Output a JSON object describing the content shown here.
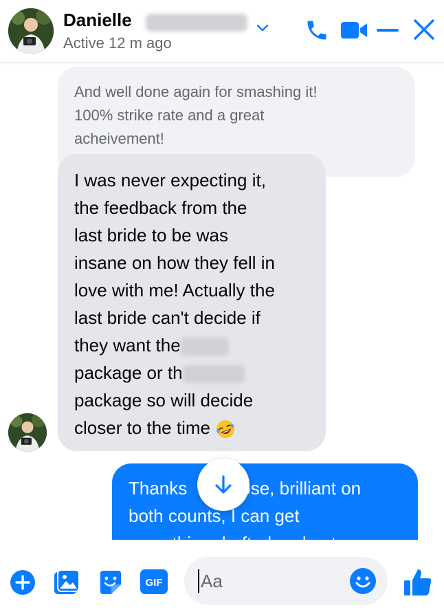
{
  "header": {
    "name": "Danielle",
    "status": "Active 12 m ago",
    "accent_color": "#0a7cff",
    "icons": [
      "chevron-down-icon",
      "phone-icon",
      "video-icon",
      "minimize-icon",
      "close-icon"
    ]
  },
  "messages": {
    "m1": {
      "lines": [
        "And well done again for smashing it!",
        "100% strike rate and a great",
        "acheivement!"
      ]
    },
    "m2": {
      "lines": [
        "I was never expecting it,",
        "the feedback from the",
        "last bride to be was",
        "insane on how they fell in",
        "love with me! Actually the",
        "last bride can't decide if",
        "they want the",
        "package or th",
        "package so will decide",
        "closer to the time"
      ]
    },
    "m3": {
      "lines": [
        "Thanks",
        "ose, brilliant on",
        "both counts, I can get",
        "something drafted and get a"
      ]
    }
  },
  "composer": {
    "placeholder": "Aa",
    "icons": [
      "plus-icon",
      "photo-icon",
      "sticker-icon",
      "gif-icon",
      "emoji-icon",
      "thumbs-up-icon"
    ],
    "gif_label": "GIF"
  }
}
